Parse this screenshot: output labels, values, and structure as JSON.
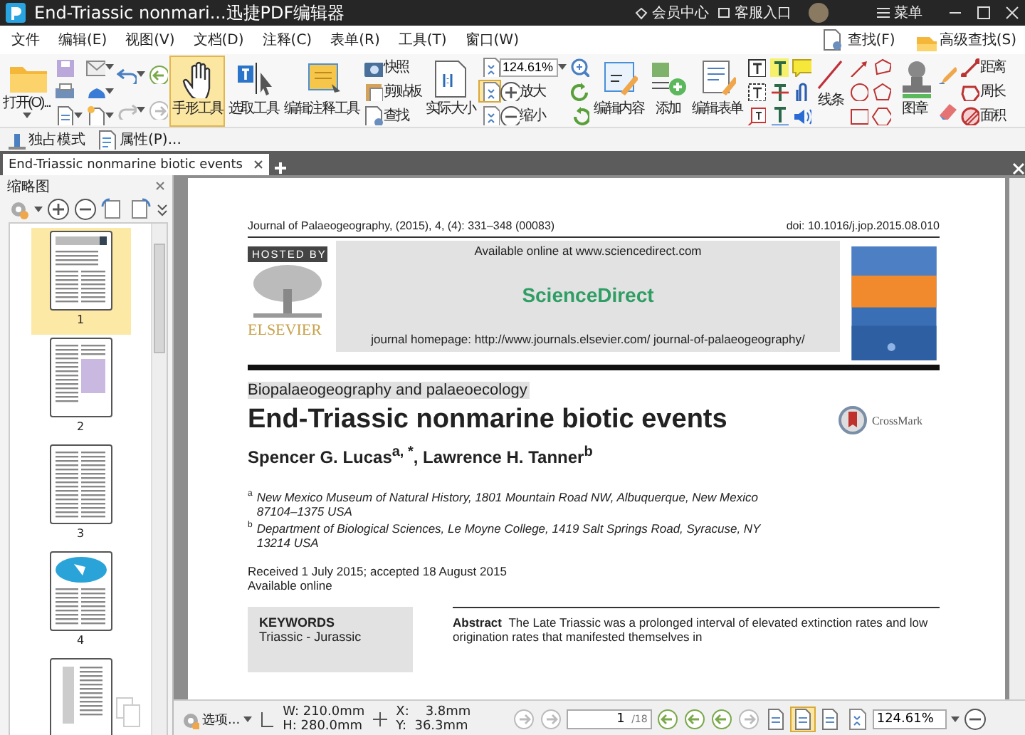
{
  "window": {
    "title": "End-Triassic nonmari...迅捷PDF编辑器",
    "links": [
      "会员中心",
      "客服入口"
    ],
    "menu_button": "菜单"
  },
  "menu": [
    "文件",
    "编辑(E)",
    "视图(V)",
    "文档(D)",
    "注释(C)",
    "表单(R)",
    "工具(T)",
    "窗口(W)"
  ],
  "search": [
    "查找(F)",
    "高级查找(S)"
  ],
  "ribbon": {
    "open": "打开(O)...",
    "tools": [
      {
        "label": "手形工具",
        "selected": true
      },
      {
        "label": "选取工具",
        "selected": false
      },
      {
        "label": "编辑注释工具",
        "selected": false
      }
    ],
    "clip": [
      "快照",
      "剪贴板",
      "查找"
    ],
    "actual_size": "实际大小",
    "zoom_value": "124.61%",
    "zoom": [
      "放大",
      "缩小"
    ],
    "edit": [
      "编辑内容",
      "添加",
      "编辑表单"
    ],
    "line": "线条",
    "stamp": "图章",
    "measure": [
      "距离",
      "周长",
      "面积"
    ]
  },
  "mode_bar": [
    "独占模式",
    "属性(P)..."
  ],
  "tabs": [
    {
      "label": "End-Triassic nonmarine biotic events",
      "selected": true
    }
  ],
  "thumbnails": {
    "title": "缩略图",
    "pages": [
      {
        "label": "1",
        "selected": true
      },
      {
        "label": "2",
        "selected": false
      },
      {
        "label": "3",
        "selected": false
      },
      {
        "label": "4",
        "selected": false
      },
      {
        "selected": false
      }
    ]
  },
  "document": {
    "journal_line": "Journal of Palaeogeography, (2015), 4, (4): 331–348 (00083)",
    "doi": "doi: 10.1016/j.jop.2015.08.010",
    "hosted_by": "HOSTED BY",
    "publisher": "ELSEVIER",
    "available": "Available online at www.sciencedirect.com",
    "brand": "ScienceDirect",
    "homepage": "journal homepage: http://www.journals.elsevier.com/ journal-of-palaeogeography/",
    "section": "Biopalaeogeography and palaeoecology",
    "title": "End-Triassic nonmarine biotic events",
    "authors": "Spencer G. Lucas$^{a, *}$, Lawrence H. Tanner$^{b}$",
    "crossmark": "CrossMark",
    "affiliations": [
      {
        "mark": "a",
        "text": "New Mexico Museum of Natural History, 1801 Mountain Road NW, Albuquerque, New Mexico 87104–1375 USA"
      },
      {
        "mark": "b",
        "text": "Department of Biological Sciences, Le Moyne College, 1419 Salt Springs Road, Syracuse, NY 13214 USA"
      }
    ],
    "received": "Received 1 July 2015; accepted 18 August 2015",
    "available_online": "Available online",
    "keywords_title": "KEYWORDS",
    "keywords": [
      "Triassic - Jurassic"
    ],
    "abstract_label": "Abstract",
    "abstract_lines": [
      "The Late Triassic was a prolonged interval of elevated extinction rates and low",
      "origination rates that manifested themselves in"
    ]
  },
  "status_bar": {
    "options": "选项...",
    "width": "W: 210.0mm",
    "height": "H: 280.0mm",
    "x": "X:    3.8mm",
    "y": "Y:  36.3mm",
    "page": "1",
    "page_count": "/18",
    "zoom": "124.61%"
  }
}
